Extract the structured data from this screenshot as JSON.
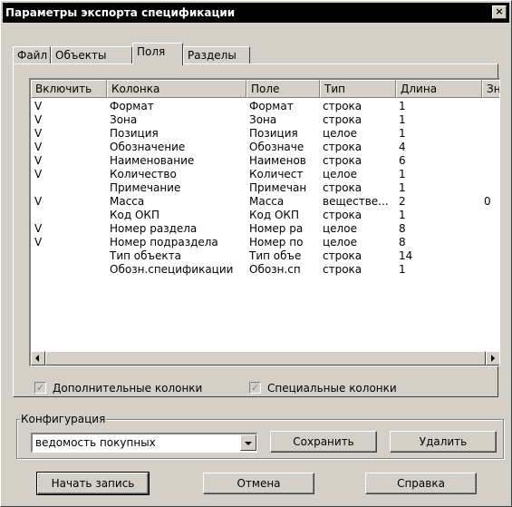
{
  "dialog": {
    "title": "Параметры экспорта спецификации",
    "close_label": "×"
  },
  "tabs": [
    {
      "label": "Файл"
    },
    {
      "label": "Объекты"
    },
    {
      "label": "Поля"
    },
    {
      "label": "Разделы"
    }
  ],
  "table": {
    "columns": [
      "Включить",
      "Колонка",
      "Поле",
      "Тип",
      "Длина",
      "Зн"
    ],
    "rows": [
      [
        "V",
        "Формат",
        "Формат",
        "строка",
        "1",
        ""
      ],
      [
        "V",
        "Зона",
        "Зона",
        "строка",
        "1",
        ""
      ],
      [
        "V",
        "Позиция",
        "Позиция",
        "целое",
        "1",
        ""
      ],
      [
        "V",
        "Обозначение",
        "Обозначе",
        "строка",
        "4",
        ""
      ],
      [
        "V",
        "Наименование",
        "Наименов",
        "строка",
        "6",
        ""
      ],
      [
        "V",
        "Количество",
        "Количест",
        "целое",
        "1",
        ""
      ],
      [
        "",
        "Примечание",
        "Примечан",
        "строка",
        "1",
        ""
      ],
      [
        "V",
        "Масса",
        "Масса",
        "веществе...",
        "2",
        "0"
      ],
      [
        "",
        "Код ОКП",
        "Код ОКП",
        "строка",
        "1",
        ""
      ],
      [
        "V",
        "Номер раздела",
        "Номер ра",
        "целое",
        "8",
        ""
      ],
      [
        "V",
        "Номер подраздела",
        "Номер по",
        "целое",
        "8",
        ""
      ],
      [
        "",
        "Тип объекта",
        "Тип объе",
        "строка",
        "14",
        ""
      ],
      [
        "",
        "Обозн.спецификации",
        "Обозн.сп",
        "строка",
        "1",
        ""
      ]
    ]
  },
  "checkboxes": {
    "extra_columns": {
      "label": "Дополнительные колонки",
      "checked": true
    },
    "special_columns": {
      "label": "Специальные колонки",
      "checked": true
    }
  },
  "configuration": {
    "group_label": "Конфигурация",
    "selected": "ведомость покупных",
    "save_label": "Сохранить",
    "delete_label": "Удалить"
  },
  "footer": {
    "start_label": "Начать запись",
    "cancel_label": "Отмена",
    "help_label": "Справка"
  }
}
